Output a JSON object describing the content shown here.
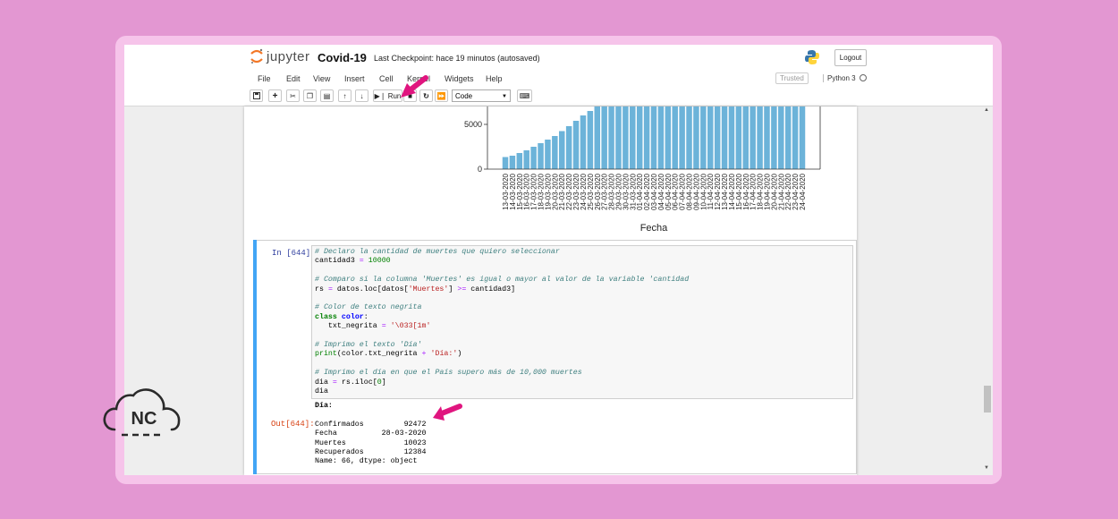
{
  "app": {
    "logo_text": "jupyter",
    "notebook_title": "Covid-19",
    "checkpoint": "Last Checkpoint: hace 19 minutos  (autosaved)",
    "logout_label": "Logout",
    "trusted_label": "Trusted",
    "kernel_label": "Python 3"
  },
  "menu": {
    "items": [
      "File",
      "Edit",
      "View",
      "Insert",
      "Cell",
      "Kernel",
      "Widgets",
      "Help"
    ]
  },
  "toolbar": {
    "run_label": "Run",
    "cell_type": "Code",
    "icons": [
      "save-icon",
      "plus-icon",
      "cut-icon",
      "copy-icon",
      "paste-icon",
      "arrow-up-icon",
      "arrow-down-icon",
      "run-icon",
      "stop-icon",
      "restart-icon",
      "fast-forward-icon",
      "keyboard-icon"
    ]
  },
  "chart_data": {
    "type": "bar",
    "xlabel": "Fecha",
    "ylabel": "",
    "ylim": [
      0,
      7000
    ],
    "yticks": [
      0,
      5000
    ],
    "color": "#6cb3d9",
    "categories": [
      "13-03-2020",
      "14-03-2020",
      "15-03-2020",
      "16-03-2020",
      "17-03-2020",
      "18-03-2020",
      "19-03-2020",
      "20-03-2020",
      "21-03-2020",
      "22-03-2020",
      "23-03-2020",
      "24-03-2020",
      "25-03-2020",
      "26-03-2020",
      "27-03-2020",
      "28-03-2020",
      "29-03-2020",
      "30-03-2020",
      "31-03-2020",
      "01-04-2020",
      "02-04-2020",
      "03-04-2020",
      "04-04-2020",
      "05-04-2020",
      "06-04-2020",
      "07-04-2020",
      "08-04-2020",
      "09-04-2020",
      "10-04-2020",
      "11-04-2020",
      "12-04-2020",
      "13-04-2020",
      "14-04-2020",
      "15-04-2020",
      "16-04-2020",
      "17-04-2020",
      "18-04-2020",
      "19-04-2020",
      "20-04-2020",
      "21-04-2020",
      "22-04-2020",
      "23-04-2020",
      "24-04-2020"
    ],
    "values": [
      1350,
      1500,
      1800,
      2100,
      2500,
      2900,
      3300,
      3700,
      4250,
      4800,
      5400,
      6000,
      6500,
      7000,
      7000,
      7000,
      7000,
      7000,
      7000,
      7000,
      7000,
      7000,
      7000,
      7000,
      7000,
      7000,
      7000,
      7000,
      7000,
      7000,
      7000,
      7000,
      7000,
      7000,
      7000,
      7000,
      7000,
      7000,
      7000,
      7000,
      7000,
      7000,
      7000
    ]
  },
  "cell": {
    "in_prompt": "In [644]:",
    "out_prompt": "Out[644]:",
    "code": {
      "c1": "# Declaro la cantidad de muertes que quiero seleccionar",
      "l2a": "cantidad3 ",
      "l2op": "=",
      "l2num": "10000",
      "c4": "# Comparo si la columna 'Muertes' es igual o mayor al valor de la variable 'cantidad",
      "l5a": "rs ",
      "l5op1": "=",
      "l5b": " datos.loc[datos[",
      "l5str": "'Muertes'",
      "l5c": "] ",
      "l5op2": ">=",
      "l5d": " cantidad3]",
      "c7": "# Color de texto negrita",
      "l8kw": "class",
      "l8name": "color",
      "l8rest": ":",
      "l9a": "   txt_negrita ",
      "l9op": "=",
      "l9str": "'\\033[1m'",
      "c11": "# Imprimo el texto 'Día'",
      "l12kw": "print",
      "l12a": "(color.txt_negrita ",
      "l12op": "+",
      "l12str": "'Día:'",
      "l12b": ")",
      "c14": "# Imprimo el día en que el País supero más de 10,000 muertes",
      "l15a": "dia ",
      "l15op": "=",
      "l15b": " rs.iloc[",
      "l15num": "0",
      "l15c": "]",
      "l16": "dia"
    },
    "stdout": "Día:",
    "output_rows": [
      "Confirmados         92472",
      "Fecha          28-03-2020",
      "Muertes             10023",
      "Recuperados         12384",
      "Name: 66, dtype: object"
    ]
  },
  "branding": {
    "nc_text": "NC"
  },
  "colors": {
    "background": "#e397d2",
    "frame": "#f6c4ea",
    "annotation_arrow": "#e0157f",
    "cell_selected": "#42a5f5",
    "bar": "#6cb3d9"
  }
}
